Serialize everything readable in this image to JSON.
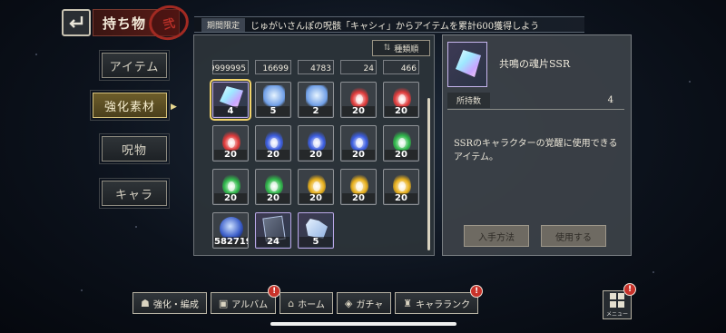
{
  "header": {
    "title": "持ち物",
    "seal_text": "弐",
    "notice_tag": "期間限定",
    "notice_text": "じゅがいさんぽの呪骸「キャシィ」からアイテムを累計600獲得しよう"
  },
  "sidebar": {
    "items": [
      {
        "label": "アイテム"
      },
      {
        "label": "強化素材"
      },
      {
        "label": "呪物"
      },
      {
        "label": "キャラ"
      }
    ],
    "active_index": 1
  },
  "inventory": {
    "sort_label": "種類順",
    "top_row": [
      "9999995",
      "16699",
      "4783",
      "24",
      "466"
    ],
    "items": [
      {
        "icon": "crystal-ssr-icon",
        "qty": "4",
        "kind": "crystal",
        "selected": true
      },
      {
        "icon": "spirit-figure-icon",
        "qty": "5",
        "kind": "spirit"
      },
      {
        "icon": "spirit-figure-icon",
        "qty": "2",
        "kind": "spirit"
      },
      {
        "icon": "red-flame-icon",
        "qty": "20",
        "kind": "flame",
        "color": "#e03a3a"
      },
      {
        "icon": "red-flame-icon",
        "qty": "20",
        "kind": "flame",
        "color": "#e03a3a"
      },
      {
        "icon": "red-flame-icon",
        "qty": "20",
        "kind": "flame",
        "color": "#e03a3a"
      },
      {
        "icon": "blue-flame-icon",
        "qty": "20",
        "kind": "flame",
        "color": "#3b5de0"
      },
      {
        "icon": "blue-flame-icon",
        "qty": "20",
        "kind": "flame",
        "color": "#3b5de0"
      },
      {
        "icon": "blue-flame-icon",
        "qty": "20",
        "kind": "flame",
        "color": "#3b5de0"
      },
      {
        "icon": "green-flame-icon",
        "qty": "20",
        "kind": "flame",
        "color": "#2fb84a"
      },
      {
        "icon": "green-flame-icon",
        "qty": "20",
        "kind": "flame",
        "color": "#2fb84a"
      },
      {
        "icon": "green-flame-icon",
        "qty": "20",
        "kind": "flame",
        "color": "#2fb84a"
      },
      {
        "icon": "yellow-flame-icon",
        "qty": "20",
        "kind": "flame",
        "color": "#e8b01c"
      },
      {
        "icon": "yellow-flame-icon",
        "qty": "20",
        "kind": "flame",
        "color": "#e8b01c"
      },
      {
        "icon": "yellow-flame-icon",
        "qty": "20",
        "kind": "flame",
        "color": "#e8b01c"
      },
      {
        "icon": "blue-orb-icon",
        "qty": "5827193",
        "kind": "orb"
      },
      {
        "icon": "card-stack-icon",
        "qty": "24",
        "kind": "cards"
      },
      {
        "icon": "gem-cluster-icon",
        "qty": "5",
        "kind": "gems"
      }
    ]
  },
  "detail": {
    "name": "共鳴の魂片SSR",
    "owned_label": "所持数",
    "owned_value": "4",
    "description": "SSRのキャラクターの覚醒に使用できるアイテム。",
    "acquire_button": "入手方法",
    "use_button": "使用する"
  },
  "bottom_nav": [
    {
      "label": "強化・編成",
      "icon": "people-icon",
      "glyph": "☗",
      "badge": ""
    },
    {
      "label": "アルバム",
      "icon": "album-icon",
      "glyph": "▣",
      "badge": "!"
    },
    {
      "label": "ホーム",
      "icon": "home-icon",
      "glyph": "⌂",
      "badge": ""
    },
    {
      "label": "ガチャ",
      "icon": "gacha-icon",
      "glyph": "◈",
      "badge": ""
    },
    {
      "label": "キャラランク",
      "icon": "rank-icon",
      "glyph": "♜",
      "badge": "!"
    }
  ],
  "menu": {
    "label": "メニュー",
    "badge": "!"
  },
  "colors": {
    "accent_gold": "#d4c07a",
    "banner_red": "#5a1c18",
    "badge_red": "#c8322a"
  }
}
